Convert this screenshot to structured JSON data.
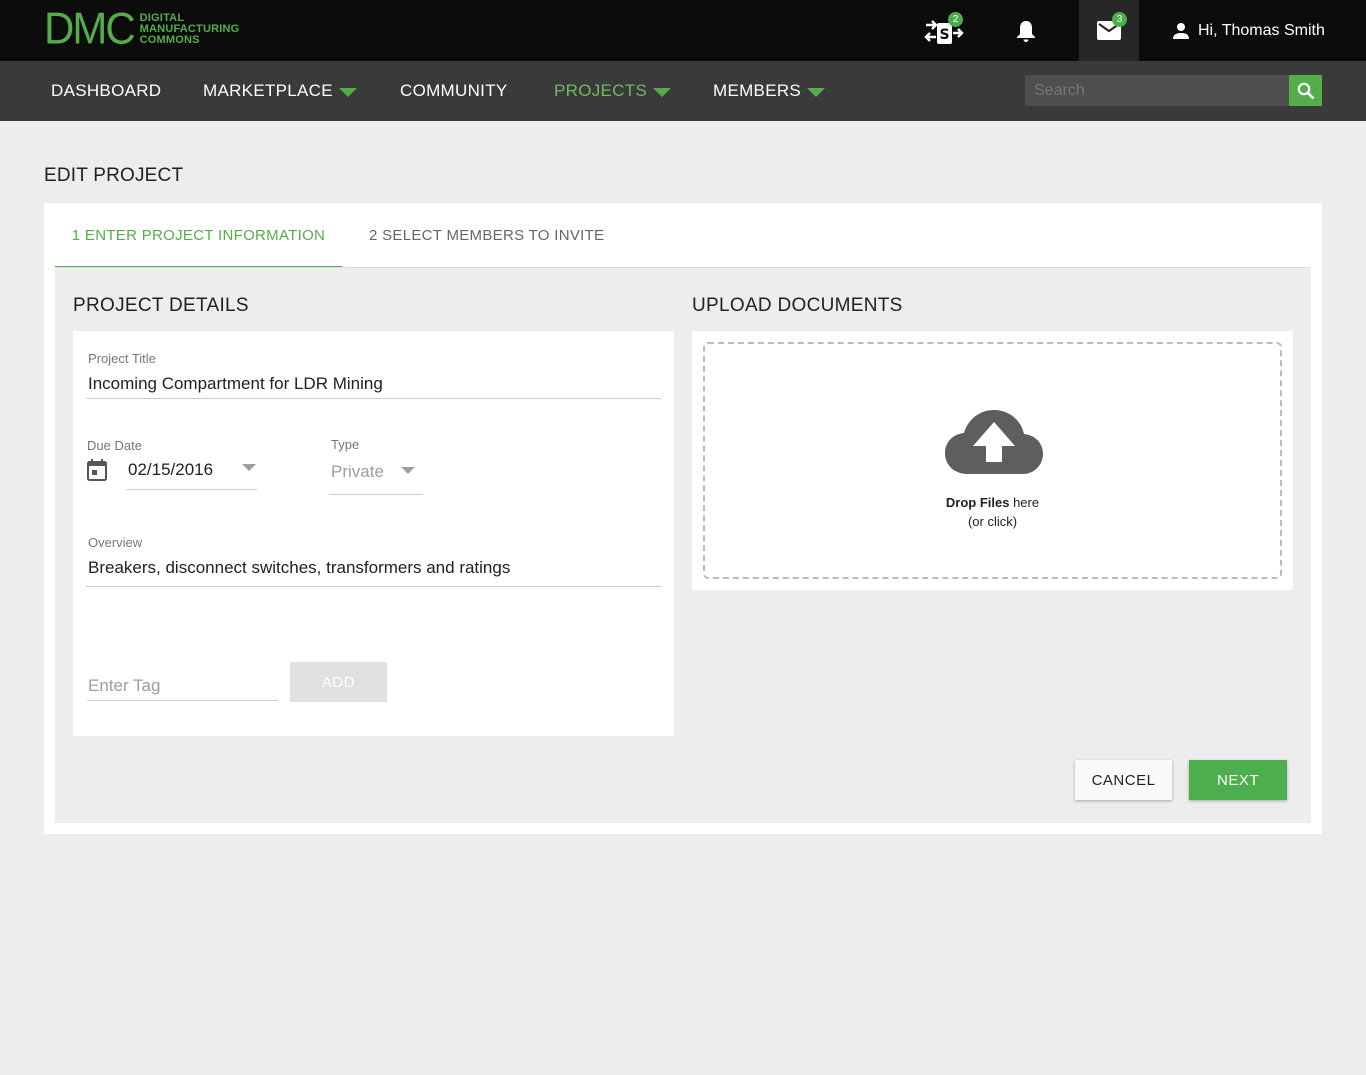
{
  "header": {
    "logo_mark": "DMC",
    "logo_lines": [
      "DIGITAL",
      "MANUFACTURING",
      "COMMONS"
    ],
    "compare_badge": "2",
    "mail_badge": "3",
    "user_greeting": "Hi, Thomas Smith"
  },
  "nav": {
    "items": [
      {
        "label": "DASHBOARD"
      },
      {
        "label": "MARKETPLACE"
      },
      {
        "label": "COMMUNITY"
      },
      {
        "label": "PROJECTS"
      },
      {
        "label": "MEMBERS"
      }
    ],
    "active": "PROJECTS",
    "search_placeholder": "Search"
  },
  "page": {
    "title": "EDIT PROJECT"
  },
  "tabs": [
    {
      "label": "1 ENTER PROJECT INFORMATION"
    },
    {
      "label": "2 SELECT MEMBERS TO INVITE"
    }
  ],
  "details": {
    "section_title": "PROJECT DETAILS",
    "project_title_label": "Project Title",
    "project_title_value": "Incoming Compartment for LDR Mining",
    "due_date_label": "Due Date",
    "due_date_value": "02/15/2016",
    "type_label": "Type",
    "type_value": "Private",
    "overview_label": "Overview",
    "overview_value": "Breakers, disconnect switches, transformers and ratings",
    "tag_placeholder": "Enter Tag",
    "add_label": "ADD"
  },
  "upload": {
    "section_title": "UPLOAD DOCUMENTS",
    "drop_bold": "Drop Files",
    "drop_rest": " here",
    "drop_sub": "(or click)"
  },
  "actions": {
    "cancel": "CANCEL",
    "next": "NEXT"
  },
  "colors": {
    "brand_green": "#55ad4a",
    "topbar": "#0c0c0c",
    "navbar": "#3a3a3a"
  }
}
